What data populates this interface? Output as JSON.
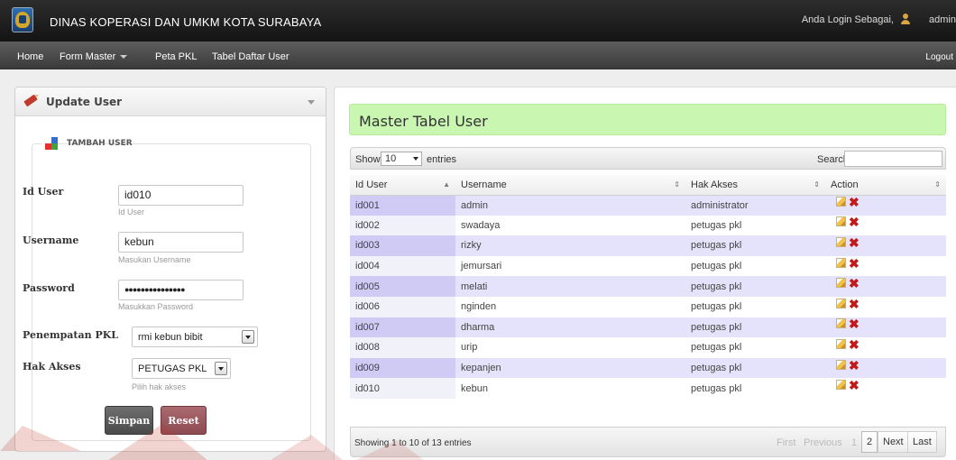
{
  "header": {
    "app_title": "DINAS KOPERASI DAN UMKM KOTA SURABAYA",
    "login_text": "Anda Login Sebagai,",
    "login_user": "admin"
  },
  "nav": {
    "items": [
      "Home",
      "Form Master",
      "Peta PKL",
      "Tabel Daftar User"
    ],
    "logout": "Logout"
  },
  "form": {
    "panel_title": "Update User",
    "section_title": "TAMBAH USER",
    "id_user_label": "Id User",
    "id_user_value": "id010",
    "id_user_help": "Id User",
    "username_label": "Username",
    "username_value": "kebun",
    "username_help": "Masukan Username",
    "password_label": "Password",
    "password_value": "●●●●●●●●●●●●●●●",
    "password_help": "Masukkan Password",
    "penempatan_label": "Penempatan PKL",
    "penempatan_value": "rmi kebun bibit",
    "hak_label": "Hak Akses",
    "hak_value": "PETUGAS PKL",
    "hak_help": "Pilih hak akses",
    "save_label": "Simpan",
    "reset_label": "Reset"
  },
  "table": {
    "title": "Master Tabel User",
    "show_label": "Show",
    "page_size": "10",
    "entries_label": "entries",
    "search_label": "Search:",
    "columns": [
      "Id User",
      "Username",
      "Hak Akses",
      "Action"
    ],
    "rows": [
      [
        "id001",
        "admin",
        "administrator"
      ],
      [
        "id002",
        "swadaya",
        "petugas pkl"
      ],
      [
        "id003",
        "rizky",
        "petugas pkl"
      ],
      [
        "id004",
        "jemursari",
        "petugas pkl"
      ],
      [
        "id005",
        "melati",
        "petugas pkl"
      ],
      [
        "id006",
        "nginden",
        "petugas pkl"
      ],
      [
        "id007",
        "dharma",
        "petugas pkl"
      ],
      [
        "id008",
        "urip",
        "petugas pkl"
      ],
      [
        "id009",
        "kepanjen",
        "petugas pkl"
      ],
      [
        "id010",
        "kebun",
        "petugas pkl"
      ]
    ],
    "info": "Showing 1 to 10 of 13 entries",
    "pagination": {
      "first": "First",
      "previous": "Previous",
      "pages": [
        "1",
        "2"
      ],
      "next": "Next",
      "last": "Last"
    }
  },
  "colors": {
    "title_bg": "#c9f7b2",
    "odd_row": "#e5e3fb",
    "sorted_col": "#cfcbf5",
    "delete": "#c21a1a",
    "watermark": "#c0392b"
  },
  "icons": [
    "logo-seal",
    "user-icon",
    "pencil-icon",
    "collapse-icon",
    "blocks-icon",
    "edit-icon",
    "delete-icon"
  ]
}
